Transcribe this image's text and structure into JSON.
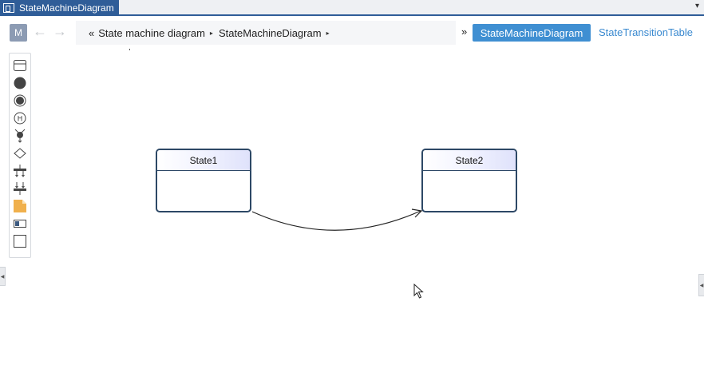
{
  "tab": {
    "title": "StateMachineDiagram",
    "icon": "diagram-icon"
  },
  "toolbar": {
    "model_button": "M",
    "back_icon": "←",
    "forward_icon": "→",
    "breadcrumb": {
      "lead": "«",
      "items": [
        "State machine diagram",
        "StateMachineDiagram"
      ],
      "separator": "▸"
    },
    "more": "»",
    "view_tabs": [
      {
        "label": "StateMachineDiagram",
        "active": true
      },
      {
        "label": "StateTransitionTable",
        "active": false
      }
    ]
  },
  "palette": {
    "tools": [
      "state-tool-icon",
      "initial-state-icon",
      "final-state-icon",
      "history-state-icon",
      "entry-point-icon",
      "choice-icon",
      "fork-icon",
      "join-icon",
      "note-icon",
      "text-box-icon",
      "frame-icon"
    ]
  },
  "diagram": {
    "states": [
      {
        "name": "State1"
      },
      {
        "name": "State2"
      }
    ],
    "transitions": [
      {
        "from": "State1",
        "to": "State2"
      }
    ]
  },
  "colors": {
    "accent": "#2f5d98",
    "active_tab": "#3f8fd2",
    "state_border": "#2d4866",
    "note": "#f0b04c"
  }
}
